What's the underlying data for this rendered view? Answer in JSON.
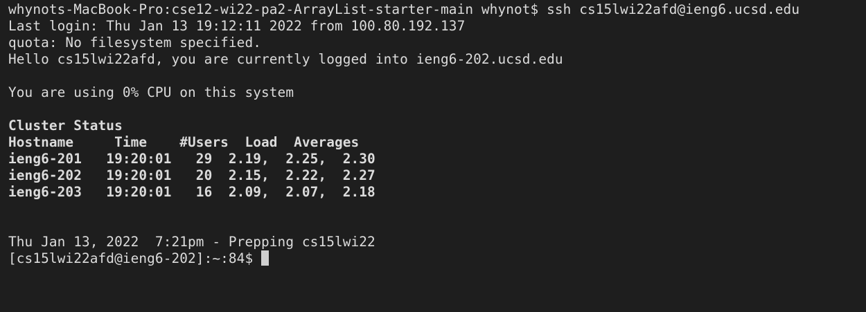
{
  "terminal": {
    "lines": [
      {
        "text": "whynots-MacBook-Pro:cse12-wi22-pa2-ArrayList-starter-main whynot$ ssh cs15lwi22afd@ieng6.ucsd.edu",
        "bold": false
      },
      {
        "text": "Last login: Thu Jan 13 19:12:11 2022 from 100.80.192.137",
        "bold": false
      },
      {
        "text": "quota: No filesystem specified.",
        "bold": false
      },
      {
        "text": "Hello cs15lwi22afd, you are currently logged into ieng6-202.ucsd.edu",
        "bold": false
      },
      {
        "text": "",
        "bold": false
      },
      {
        "text": "You are using 0% CPU on this system",
        "bold": false
      },
      {
        "text": "",
        "bold": false
      },
      {
        "text": "Cluster Status",
        "bold": true
      },
      {
        "text": "Hostname     Time    #Users  Load  Averages",
        "bold": true
      },
      {
        "text": "ieng6-201   19:20:01   29  2.19,  2.25,  2.30",
        "bold": true
      },
      {
        "text": "ieng6-202   19:20:01   20  2.15,  2.22,  2.27",
        "bold": true
      },
      {
        "text": "ieng6-203   19:20:01   16  2.09,  2.07,  2.18",
        "bold": true
      },
      {
        "text": "",
        "bold": false
      },
      {
        "text": "",
        "bold": false
      },
      {
        "text": "Thu Jan 13, 2022  7:21pm - Prepping cs15lwi22",
        "bold": false
      }
    ],
    "prompt": "[cs15lwi22afd@ieng6-202]:~:84$ ",
    "colors": {
      "background": "#1e1e1e",
      "foreground": "#dcdcdc",
      "cursor": "#d0d0d0"
    }
  }
}
